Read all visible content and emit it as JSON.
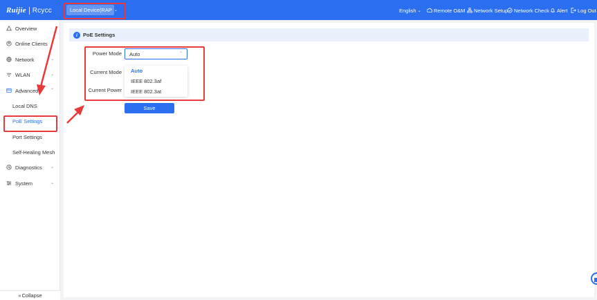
{
  "header": {
    "logo_brand": "Ruijie",
    "logo_product": "Rcycc",
    "device_select": "Local Device(RAP",
    "device_select_icon": "chevron-down-icon",
    "language": "English",
    "remote_om": "Remote O&M",
    "network_setup": "Network Setup",
    "network_check": "Network Check",
    "alert": "Alert",
    "logout": "Log Out"
  },
  "sidebar": {
    "items": [
      {
        "label": "Overview",
        "icon": "overview-icon"
      },
      {
        "label": "Online Clients",
        "icon": "clients-icon"
      },
      {
        "label": "Network",
        "icon": "globe-icon"
      },
      {
        "label": "WLAN",
        "icon": "wifi-icon"
      },
      {
        "label": "Advanced",
        "icon": "advanced-icon"
      },
      {
        "label": "Local DNS"
      },
      {
        "label": "PoE Settings"
      },
      {
        "label": "Port Settings"
      },
      {
        "label": "Self-Healing Mesh"
      },
      {
        "label": "Diagnostics",
        "icon": "diagnostics-icon"
      },
      {
        "label": "System",
        "icon": "system-icon"
      }
    ],
    "collapse": "Collapse"
  },
  "main": {
    "section_title": "PoE Settings",
    "power_mode_label": "Power Mode",
    "power_mode_value": "Auto",
    "current_mode_label": "Current Mode",
    "current_power_label": "Current Power",
    "dropdown_options": [
      "Auto",
      "IEEE 802.3af",
      "IEEE 802.3at"
    ],
    "save_label": "Save"
  },
  "colors": {
    "primary": "#2b6ef0",
    "highlight_box": "#e83a3a",
    "background": "#f2f3f5"
  }
}
